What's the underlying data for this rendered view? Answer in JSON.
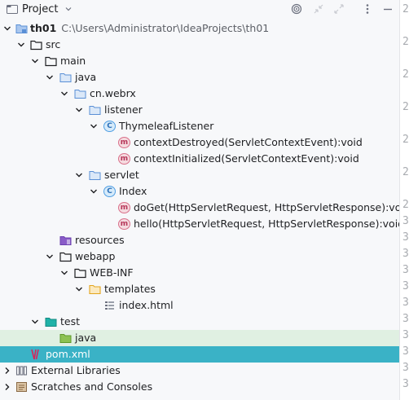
{
  "header": {
    "title": "Project",
    "icons": [
      "project-icon",
      "chevron-down-icon",
      "target-icon",
      "collapse-icon",
      "expand-icon",
      "more-icon",
      "minimize-icon"
    ]
  },
  "gutter": {
    "line_numbers": [
      "2",
      "2",
      "2",
      "2",
      "2",
      "2",
      "2",
      "3",
      "3",
      "3",
      "3",
      "3",
      "3",
      "3",
      "3",
      "3",
      "3",
      "3",
      "3",
      "3",
      "3",
      "3",
      "3",
      "3"
    ]
  },
  "tree": {
    "root": {
      "name": "th01",
      "path": "C:\\Users\\Administrator\\IdeaProjects\\th01"
    },
    "src": "src",
    "main": "main",
    "java": "java",
    "pkg": "cn.webrx",
    "listener": "listener",
    "listener_class": "ThymeleafListener",
    "m_destroyed": "contextDestroyed(ServletContextEvent):void",
    "m_initialized": "contextInitialized(ServletContextEvent):void",
    "servlet": "servlet",
    "servlet_class": "Index",
    "m_doget": "doGet(HttpServletRequest, HttpServletResponse):void",
    "m_hello": "hello(HttpServletRequest, HttpServletResponse):void",
    "resources": "resources",
    "webapp": "webapp",
    "webinf": "WEB-INF",
    "templates": "templates",
    "index_html": "index.html",
    "test": "test",
    "test_java": "java",
    "pom": "pom.xml",
    "ext_libs": "External Libraries",
    "scratches": "Scratches and Consoles"
  },
  "colors": {
    "selected_row": "#3ab2c6",
    "test_java_row": "#e0f0e2",
    "folder_blue": "#8fb8e8",
    "folder_yellow": "#e8b84a"
  }
}
